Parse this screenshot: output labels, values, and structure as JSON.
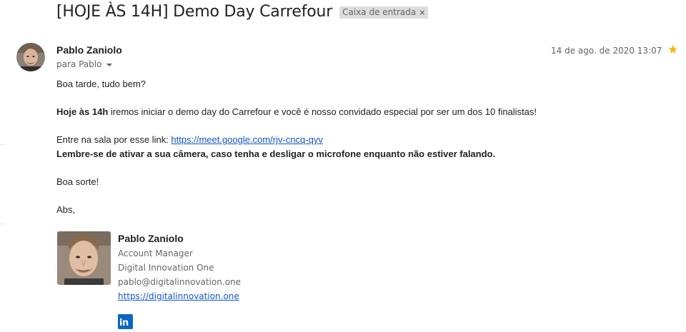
{
  "email": {
    "subject": "[HOJE ÀS 14H] Demo Day Carrefour",
    "label": "Caixa de entrada",
    "label_remove": "×",
    "sender": "Pablo Zaniolo",
    "recipient": "para Pablo",
    "date": "14 de ago. de 2020 13:07",
    "starred": true,
    "star_glyph": "★"
  },
  "body": {
    "greeting": "Boa tarde, tudo bem?",
    "p1_bold": "Hoje às 14h",
    "p1_rest": " iremos iniciar o demo day do Carrefour e você é nosso convidado especial por ser um dos 10 finalistas!",
    "p2_prefix": "Entre na sala por esse link: ",
    "p2_link": "https://meet.google.com/rjv-cncq-qyv",
    "p3_bold": "Lembre-se de ativar a sua câmera, caso tenha e desligar o microfone enquanto não estiver falando.",
    "luck": "Boa sorte!",
    "closing": "Abs,"
  },
  "signature": {
    "name": "Pablo Zaniolo",
    "title": "Account Manager",
    "company": "Digital Innovation One",
    "email": "pablo@digitalinnovation.one",
    "website": "https://digitalinnovation.one",
    "social_icon": "linkedin-icon",
    "social_text": "in"
  },
  "colors": {
    "link": "#1155cc",
    "star": "#f4b400",
    "linkedin": "#0a66c2"
  }
}
